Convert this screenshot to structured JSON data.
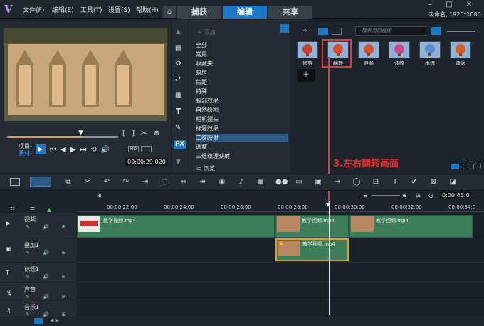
{
  "window": {
    "project_info": "未命名, 1920*1080"
  },
  "menu": [
    "文件(F)",
    "编辑(E)",
    "工具(T)",
    "设置(S)",
    "帮助(H)"
  ],
  "tabs": [
    {
      "label": "捕获"
    },
    {
      "label": "编辑"
    },
    {
      "label": "共享"
    }
  ],
  "preview": {
    "mode_project": "项目-",
    "mode_clip": "素材-",
    "timecode": "00:00:29:020"
  },
  "library": {
    "add_label": "添加",
    "search_placeholder": "搜索当前视图",
    "categories": [
      "全部",
      "常用",
      "收藏夹",
      "暗房",
      "焦距",
      "特殊",
      "脸部效果",
      "自然绘图",
      "相机镜头",
      "标题效果",
      "二维映射",
      "调整",
      "三维纹理映射"
    ],
    "selected_category": "二维映射",
    "browse_label": "浏览",
    "thumbnails": [
      {
        "label": "修剪"
      },
      {
        "label": "翻转"
      },
      {
        "label": "涟漪"
      },
      {
        "label": "波纹"
      },
      {
        "label": "水流"
      },
      {
        "label": "漩涡"
      }
    ]
  },
  "annotation": "3.左右翻转画面",
  "timeline": {
    "zoom_time": "0:00:43:0",
    "ruler": [
      "00:00:22:00",
      "00:00:24:00",
      "00:00:26:00",
      "00:00:28:00",
      "00:00:30:00",
      "00:00:32:00",
      "00:00:34:0"
    ],
    "tracks": [
      {
        "name": "视频"
      },
      {
        "name": "叠加1"
      },
      {
        "name": "标题1"
      },
      {
        "name": "声音"
      },
      {
        "name": "音乐1"
      }
    ],
    "clips": {
      "video": [
        "教学视频.mp4",
        "教学视频.mp4",
        "教学视频.mp4"
      ],
      "overlay": "教学视频.mp4"
    }
  },
  "colors": {
    "accent": "#1e78c8",
    "annotation": "#e23a3a",
    "clip": "#3c7e5a",
    "overlay_border": "#e0a020"
  }
}
